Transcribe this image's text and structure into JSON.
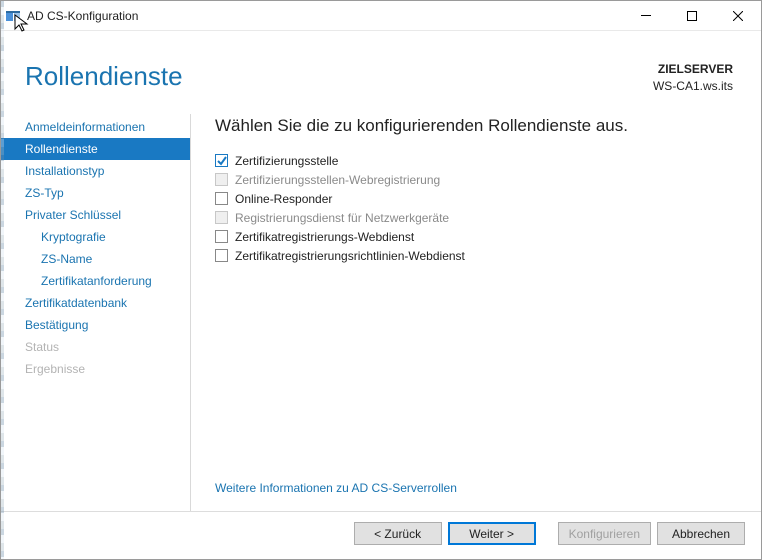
{
  "window": {
    "title": "AD CS-Konfiguration"
  },
  "header": {
    "heading": "Rollendienste",
    "target_label": "ZIELSERVER",
    "target_value": "WS-CA1.ws.its"
  },
  "sidebar": {
    "items": [
      {
        "label": "Anmeldeinformationen",
        "active": false,
        "sub": false,
        "disabled": false
      },
      {
        "label": "Rollendienste",
        "active": true,
        "sub": false,
        "disabled": false
      },
      {
        "label": "Installationstyp",
        "active": false,
        "sub": false,
        "disabled": false
      },
      {
        "label": "ZS-Typ",
        "active": false,
        "sub": false,
        "disabled": false
      },
      {
        "label": "Privater Schlüssel",
        "active": false,
        "sub": false,
        "disabled": false
      },
      {
        "label": "Kryptografie",
        "active": false,
        "sub": true,
        "disabled": false
      },
      {
        "label": "ZS-Name",
        "active": false,
        "sub": true,
        "disabled": false
      },
      {
        "label": "Zertifikatanforderung",
        "active": false,
        "sub": true,
        "disabled": false
      },
      {
        "label": "Zertifikatdatenbank",
        "active": false,
        "sub": false,
        "disabled": false
      },
      {
        "label": "Bestätigung",
        "active": false,
        "sub": false,
        "disabled": false
      },
      {
        "label": "Status",
        "active": false,
        "sub": false,
        "disabled": true
      },
      {
        "label": "Ergebnisse",
        "active": false,
        "sub": false,
        "disabled": true
      }
    ]
  },
  "main": {
    "instruction": "Wählen Sie die zu konfigurierenden Rollendienste aus.",
    "options": [
      {
        "label": "Zertifizierungsstelle",
        "checked": true,
        "disabled": false
      },
      {
        "label": "Zertifizierungsstellen-Webregistrierung",
        "checked": false,
        "disabled": true
      },
      {
        "label": "Online-Responder",
        "checked": false,
        "disabled": false
      },
      {
        "label": "Registrierungsdienst für Netzwerkgeräte",
        "checked": false,
        "disabled": true
      },
      {
        "label": "Zertifikatregistrierungs-Webdienst",
        "checked": false,
        "disabled": false
      },
      {
        "label": "Zertifikatregistrierungsrichtlinien-Webdienst",
        "checked": false,
        "disabled": false
      }
    ],
    "more_link": "Weitere Informationen zu AD CS-Serverrollen"
  },
  "footer": {
    "back": "< Zurück",
    "next": "Weiter >",
    "configure": "Konfigurieren",
    "cancel": "Abbrechen"
  }
}
